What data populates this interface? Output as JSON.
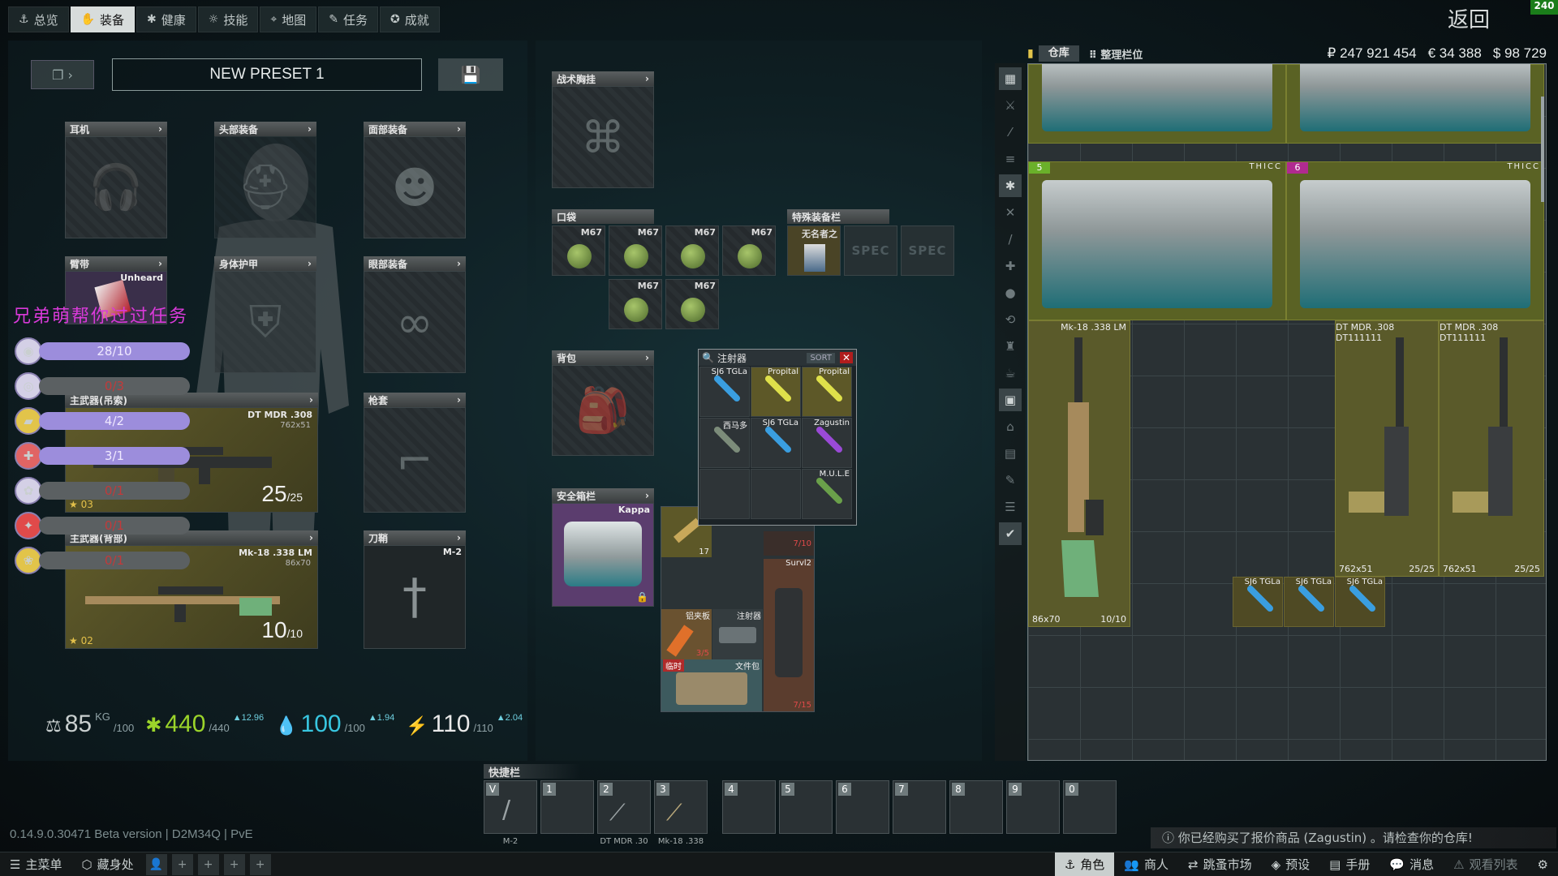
{
  "topnav": {
    "tabs": [
      {
        "label": "总览",
        "icon": "anchor-icon"
      },
      {
        "label": "装备",
        "icon": "hand-icon",
        "active": true
      },
      {
        "label": "健康",
        "icon": "asterisk-icon"
      },
      {
        "label": "技能",
        "icon": "skill-icon"
      },
      {
        "label": "地图",
        "icon": "map-pin-icon"
      },
      {
        "label": "任务",
        "icon": "task-icon"
      },
      {
        "label": "成就",
        "icon": "achievement-icon"
      }
    ],
    "back_label": "返回",
    "fps": "240"
  },
  "preset": {
    "name": "NEW PRESET 1"
  },
  "equipment": {
    "earpiece": {
      "label": "耳机"
    },
    "headwear": {
      "label": "头部装备"
    },
    "face_cover": {
      "label": "面部装备"
    },
    "armband": {
      "label": "臂带",
      "item": "Unheard"
    },
    "body_armor": {
      "label": "身体护甲"
    },
    "eyewear": {
      "label": "眼部装备"
    },
    "holster": {
      "label": "枪套"
    },
    "scabbard": {
      "label": "刀鞘",
      "item": "M-2"
    },
    "primary": {
      "label": "主武器(吊索)",
      "name": "DT MDR .308",
      "caliber": "762x51",
      "ammo": "25",
      "ammo_max": "/25",
      "rank": "03"
    },
    "primary2": {
      "label": "主武器(背部)",
      "name": "Mk-18 .338 LM",
      "caliber": "86x70",
      "ammo": "10",
      "ammo_max": "/10",
      "rank": "02"
    }
  },
  "overlay_text": "兄弟萌帮你过过任务",
  "quests": [
    {
      "progress": "28/10",
      "icon": "quest-icon-1",
      "filled": true
    },
    {
      "progress": "0/3",
      "icon": "quest-icon-2",
      "filled": false
    },
    {
      "progress": "4/2",
      "icon": "quest-icon-3",
      "filled": true
    },
    {
      "progress": "3/1",
      "icon": "quest-icon-4",
      "filled": true
    },
    {
      "progress": "0/1",
      "icon": "quest-icon-5",
      "filled": false
    },
    {
      "progress": "0/1",
      "icon": "quest-icon-6",
      "filled": false
    },
    {
      "progress": "0/1",
      "icon": "quest-icon-7",
      "filled": false
    }
  ],
  "stats": {
    "weight": "85",
    "weight_unit": "KG",
    "weight_max": "/100",
    "health": "440",
    "health_max": "/440",
    "health_delta": "▲12.96",
    "hydration": "100",
    "hydration_max": "/100",
    "hydration_delta": "▲1.94",
    "energy": "110",
    "energy_max": "/110",
    "energy_delta": "▲2.04"
  },
  "middle": {
    "rig_label": "战术胸挂",
    "pockets_label": "口袋",
    "pocket_item": "M67",
    "special_label": "特殊装备栏",
    "special_item": "无名者之",
    "spec": "SPEC",
    "backpack_label": "背包",
    "secure_label": "安全箱栏",
    "secure_item": "Kappa"
  },
  "injector": {
    "title": "注射器",
    "sort": "SORT",
    "close": "✕",
    "items": [
      "SJ6 TGLa",
      "Propital",
      "Propital",
      "西马多",
      "SJ6 TGLa",
      "Zagustin",
      "",
      "",
      "M.U.L.E"
    ]
  },
  "pack_items": {
    "first": "F",
    "first_count": "17",
    "durability": "7/10",
    "survl": "Survl2",
    "splint": "铝夹板",
    "splint_count": "3/5",
    "injector_case": "注射器",
    "temp": "临时",
    "docs": "文件包",
    "bag_count": "7/15"
  },
  "stash": {
    "tab_label": "仓库",
    "sort_label": "整理栏位",
    "rub": "₽ 247 921 454",
    "eur": "€ 34 388",
    "usd": "$ 98 729",
    "case_label": "THICC",
    "case_num_a": "5",
    "case_num_b": "6",
    "mk18_name": "Mk-18 .338 LM",
    "mk18_cal": "86x70",
    "mk18_ammo": "10/10",
    "mdr_name": "DT MDR .308 DT111111",
    "mdr_cal": "762x51",
    "mdr_ammo": "25/25",
    "syringe": "SJ6 TGLa"
  },
  "hotbar": {
    "label": "快捷栏",
    "slots": [
      {
        "key": "V",
        "cap": "M-2"
      },
      {
        "key": "1",
        "cap": ""
      },
      {
        "key": "2",
        "cap": "DT MDR .30"
      },
      {
        "key": "3",
        "cap": "Mk-18 .338"
      },
      {
        "key": "4",
        "cap": ""
      },
      {
        "key": "5",
        "cap": ""
      },
      {
        "key": "6",
        "cap": ""
      },
      {
        "key": "7",
        "cap": ""
      },
      {
        "key": "8",
        "cap": ""
      },
      {
        "key": "9",
        "cap": ""
      },
      {
        "key": "0",
        "cap": ""
      }
    ]
  },
  "version": "0.14.9.0.30471 Beta version | D2M34Q | PvE",
  "notification": "你已经购买了报价商品 (Zagustin) 。请检查你的仓库!",
  "bottombar": {
    "main_menu": "主菜单",
    "hideout": "藏身处",
    "character": "角色",
    "traders": "商人",
    "flea": "跳蚤市场",
    "presets": "预设",
    "handbook": "手册",
    "messages": "消息",
    "watchlist": "观看列表"
  },
  "colors": {
    "quest_bar": "#9c8ddc",
    "overlay_text": "#d93ad9",
    "health": "#9bd42a",
    "hydration": "#38c6e0",
    "energy": "#e9e9e9"
  }
}
